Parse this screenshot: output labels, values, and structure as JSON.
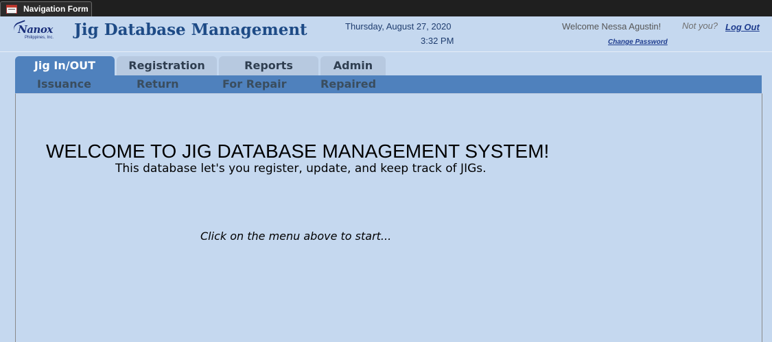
{
  "window": {
    "tab_title": "Navigation Form",
    "tab_icon": "form-icon"
  },
  "header": {
    "logo_text": "Nanox",
    "logo_subtext": "Philippines, Inc.",
    "app_title": "Jig Database Management",
    "date": "Thursday, August 27, 2020",
    "time": "3:32 PM",
    "welcome_user": "Welcome Nessa Agustin!",
    "not_you": "Not you?",
    "logout_label": "Log Out",
    "change_password_label": "Change Password"
  },
  "nav": {
    "main_tabs": [
      {
        "label": "Jig In/OUT",
        "active": true
      },
      {
        "label": "Registration",
        "active": false
      },
      {
        "label": "Reports",
        "active": false
      },
      {
        "label": "Admin",
        "active": false
      }
    ],
    "sub_tabs": [
      {
        "label": "Issuance"
      },
      {
        "label": "Return"
      },
      {
        "label": "For Repair"
      },
      {
        "label": "Repaired"
      }
    ]
  },
  "content": {
    "heading": "WELCOME TO JIG DATABASE MANAGEMENT SYSTEM!",
    "description": "This database let's you register, update, and keep track of JIGs.",
    "hint": "Click on the menu above to start..."
  },
  "colors": {
    "background": "#c5d8ef",
    "accent": "#4f81bd",
    "title": "#1e4b86",
    "link": "#1e3c8e"
  }
}
